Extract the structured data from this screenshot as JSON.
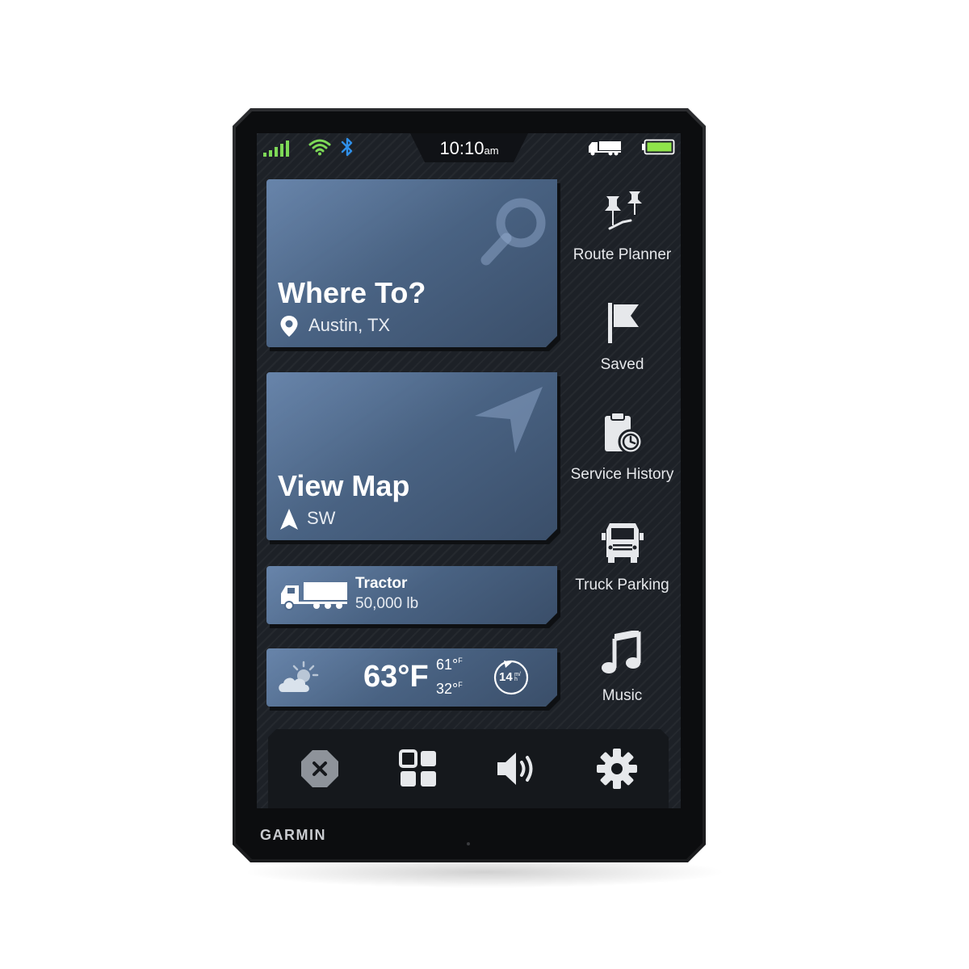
{
  "status_bar": {
    "time": "10:10",
    "time_suffix": "am",
    "icons": [
      "cell-signal-icon",
      "wifi-icon",
      "bluetooth-icon",
      "truck-profile-icon",
      "battery-icon"
    ],
    "colors": {
      "signal": "#7ed957",
      "wifi": "#7ed957",
      "bluetooth": "#2f8fe8",
      "battery": "#8fe34a"
    }
  },
  "cards": {
    "where_to": {
      "title": "Where To?",
      "subtitle": "Austin, TX",
      "icon": "magnifier-icon"
    },
    "view_map": {
      "title": "View Map",
      "subtitle": "SW",
      "icon": "navigation-arrow-icon"
    },
    "vehicle": {
      "name": "Tractor",
      "weight": "50,000 lb",
      "icon": "semi-truck-icon"
    },
    "weather": {
      "temp": "63°F",
      "high": "61°",
      "high_unit": "F",
      "low": "32°",
      "low_unit": "F",
      "wind": "14",
      "wind_unit": "m/h",
      "icon": "partly-cloudy-icon"
    }
  },
  "side_menu": [
    {
      "label": "Route Planner",
      "icon": "route-pins-icon"
    },
    {
      "label": "Saved",
      "icon": "flag-icon"
    },
    {
      "label": "Service History",
      "icon": "clipboard-clock-icon"
    },
    {
      "label": "Truck Parking",
      "icon": "truck-front-icon"
    },
    {
      "label": "Music",
      "icon": "music-note-icon"
    }
  ],
  "bottom_bar": [
    {
      "name": "stop-route-button",
      "icon": "close-octagon-icon"
    },
    {
      "name": "apps-button",
      "icon": "grid-icon"
    },
    {
      "name": "volume-button",
      "icon": "speaker-icon"
    },
    {
      "name": "settings-button",
      "icon": "gear-icon"
    }
  ],
  "brand": "GARMIN",
  "colors": {
    "card_accent": "#4b6586",
    "screen_bg": "#1d2127"
  }
}
